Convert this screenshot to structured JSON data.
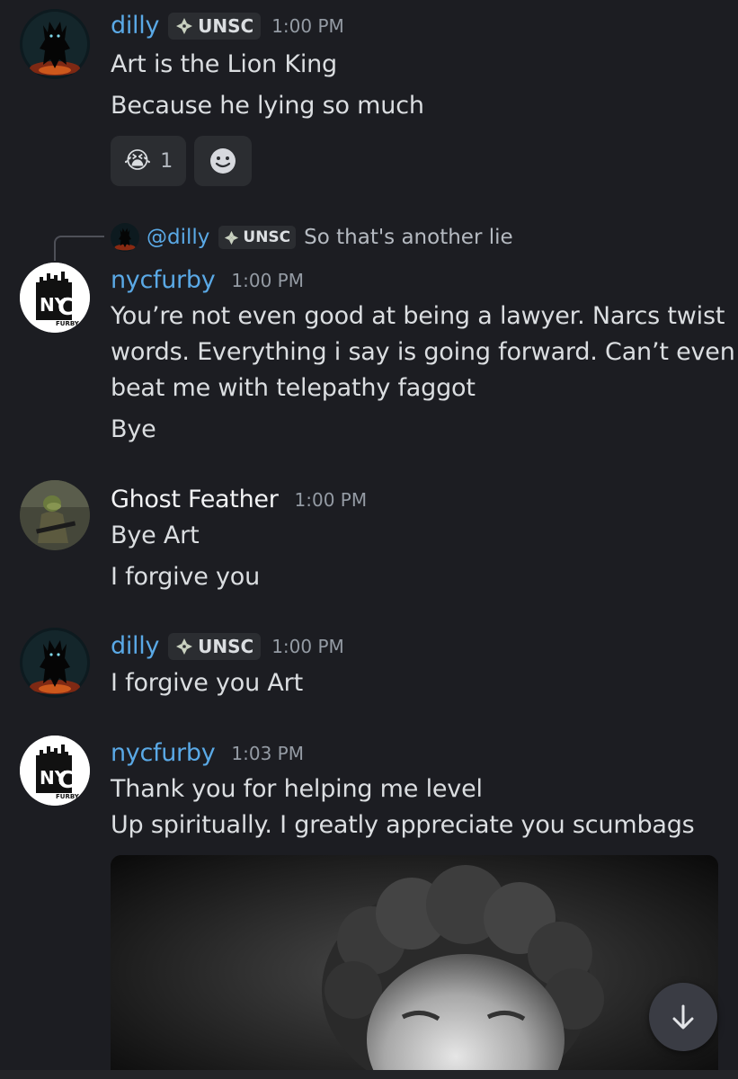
{
  "messages": [
    {
      "author": "dilly",
      "tag": "UNSC",
      "time": "1:00 PM",
      "lines": [
        "Art is the Lion King",
        "Because he lying so much"
      ],
      "reaction": {
        "emoji": "😭",
        "count": "1"
      }
    },
    {
      "reply": {
        "name": "@dilly",
        "tag": "UNSC",
        "text": "So that's another lie"
      },
      "author": "nycfurby",
      "time": "1:00 PM",
      "lines": [
        "You’re not even good at being a lawyer. Narcs twist",
        "words. Everything i say is going forward. Can’t even",
        "beat me with telepathy faggot",
        "Bye"
      ]
    },
    {
      "author": "Ghost Feather",
      "time": "1:00 PM",
      "lines": [
        "Bye Art",
        "I forgive you"
      ]
    },
    {
      "author": "dilly",
      "tag": "UNSC",
      "time": "1:00 PM",
      "lines": [
        "I forgive you Art"
      ]
    },
    {
      "author": "nycfurby",
      "time": "1:03 PM",
      "lines": [
        "Thank you for helping me level",
        "Up spiritually. I greatly appreciate you scumbags"
      ]
    }
  ],
  "logo_text": {
    "ny": "NY",
    "c": "C",
    "furby": "FURBY"
  },
  "colors": {
    "background": "#1c1d22",
    "username_blue": "#5aa9e6",
    "timestamp": "#949ba4",
    "tag_bg": "#2b2d31"
  },
  "icons": {
    "tag": "clan-diamond-icon",
    "add_reaction": "smiley-icon",
    "scroll": "arrow-down-icon"
  }
}
